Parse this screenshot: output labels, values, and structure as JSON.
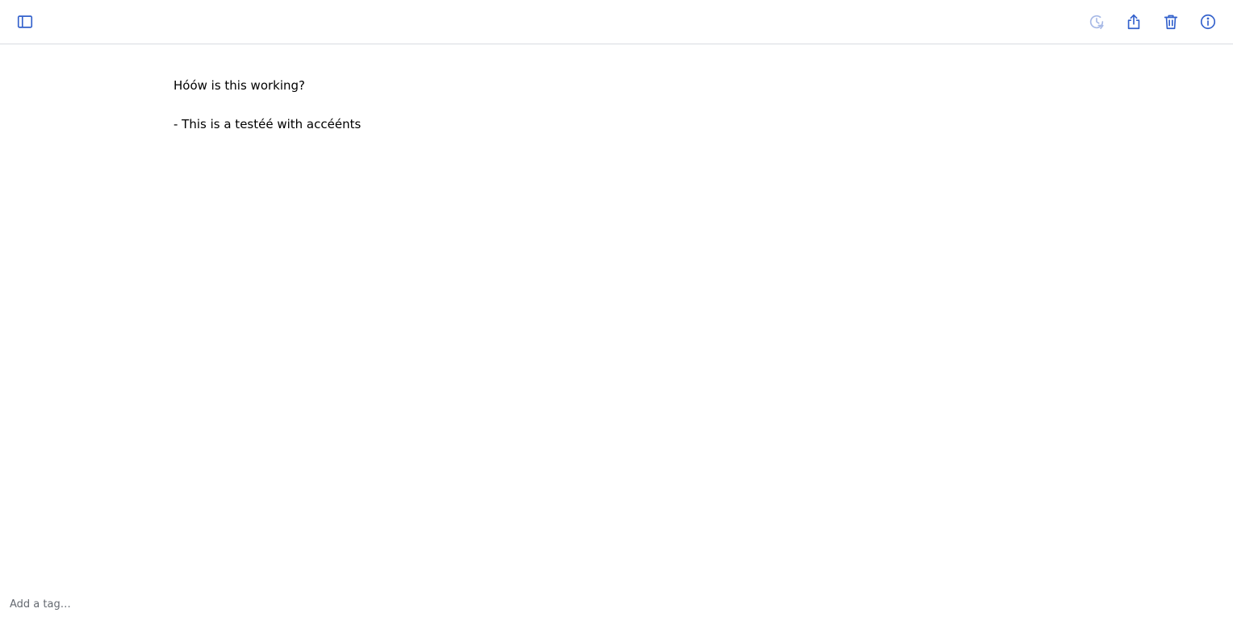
{
  "toolbar": {
    "icons": {
      "sidebar": "sidebar-toggle-icon",
      "history": "history-icon",
      "share": "share-icon",
      "trash": "trash-icon",
      "info": "info-icon"
    },
    "colors": {
      "accent": "#3361cc",
      "disabled": "#a7b9e6",
      "divider": "#d8dbe0"
    }
  },
  "note": {
    "lines": [
      "Hóów is this working?",
      "",
      "- This is a testéé with accéénts"
    ]
  },
  "tags": {
    "placeholder": "Add a tag…",
    "value": ""
  }
}
